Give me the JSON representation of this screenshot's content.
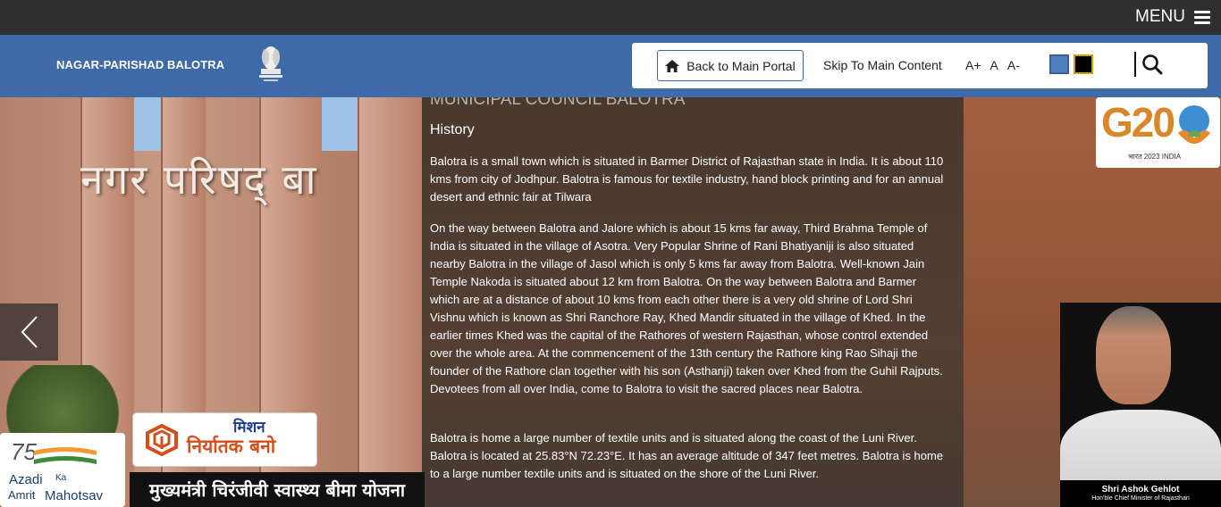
{
  "topbar": {
    "menu_label": "MENU"
  },
  "header": {
    "site_name": "NAGAR-PARISHAD BALOTRA",
    "back_label": "Back to Main Portal",
    "skip_label": "Skip To Main Content",
    "font_increase": "A+",
    "font_normal": "A",
    "font_decrease": "A-",
    "theme_colors": {
      "blue": "#4e7fc0",
      "black": "#000000"
    }
  },
  "hero": {
    "sign_text": "नगर परिषद् बा",
    "heading": "MUNICIPAL COUNCIL BALOTRA",
    "subheading": "History",
    "paragraphs": [
      "Balotra is a small town which is situated in Barmer District of Rajasthan state in India. It is about 110 kms from city of Jodhpur. Balotra is famous for textile industry, hand block printing and for an annual desert and ethnic fair at Tilwara",
      "On the way between Balotra and Jalore which is about 15 kms far away, Third Brahma Temple of India is situated in the village of Asotra. Very Popular Shrine of Rani Bhatiyaniji is also situated nearby Balotra in the village of Jasol which is only 5 kms far away from Balotra. Well-known Jain Temple Nakoda is situated about 12 km from Balotra. On the way between Balotra and Barmer which are at a distance of about 10 kms from each other there is a very old shrine of Lord Shri Vishnu which is known as Shri Ranchore Ray, Khed Mandir situated in the village of Khed. In the earlier times Khed was the capital of the Rathores of western Rajasthan, whose control extended over the whole area. At the commencement of the 13th century the Rathore king Rao Sihaji the founder of the Rathore clan together with his son (Asthanji) taken over Khed from the Guhil Rajputs. Devotees from all over India, come to Balotra to visit the sacred places near Balotra.",
      "Balotra is home a large number of textile units and is situated along the coast of the Luni River. Balotra is located at 25.83°N 72.23°E. It has an average altitude of 347 feet  metres. Balotra is home to a large number textile units and is situated on the shore of the Luni River."
    ]
  },
  "badges": {
    "g20_text": "G20",
    "g20_sub": "भारत 2023 INDIA",
    "azadi_75": "75",
    "azadi_azadi": "Azadi",
    "azadi_ka": "Ka",
    "azadi_amrit": "Amrit",
    "azadi_mahotsav": "Mahotsav",
    "mission_top": "मिशन",
    "mission_main": "निर्यातक बनो",
    "scheme_banner": "मुख्यमंत्री चिरंजीवी स्वास्थ्य बीमा योजना",
    "cm_name": "Shri Ashok Gehlot",
    "cm_title": "Hon'ble Chief Minister of Rajasthan"
  }
}
